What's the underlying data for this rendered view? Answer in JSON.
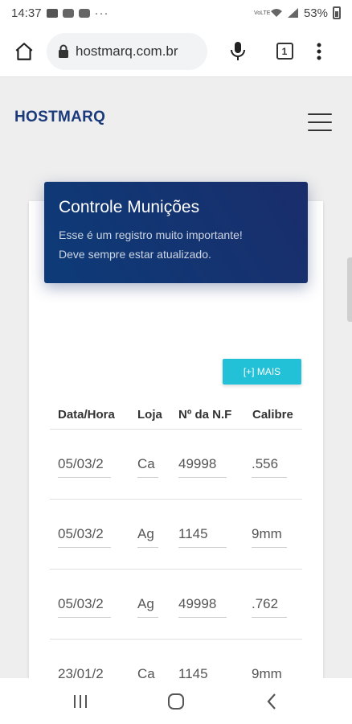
{
  "status_bar": {
    "time": "14:37",
    "icons": [
      "gallery-icon",
      "youtube-icon",
      "youtube-icon",
      "more-dots-icon"
    ],
    "more": "···",
    "network_label": "VoLTE",
    "battery": "53%"
  },
  "browser": {
    "url": "hostmarq.com.br",
    "tab_count": "1"
  },
  "page": {
    "brand": "HOSTMARQ"
  },
  "card": {
    "title": "Controle Munições",
    "subtitle": "Esse é um registro muito importante!\nDeve sempre estar atualizado.",
    "add_button": "[+] MAIS",
    "headers": [
      "Data/Hora",
      "Loja",
      "Nº da N.F",
      "Calibre"
    ],
    "rows": [
      [
        "05/03/2",
        "Ca",
        "49998",
        ".556"
      ],
      [
        "05/03/2",
        "Ag",
        "1145",
        "9mm"
      ],
      [
        "05/03/2",
        "Ag",
        "49998",
        ".762"
      ],
      [
        "23/01/2",
        "Ca",
        "1145",
        "9mm"
      ]
    ]
  },
  "colors": {
    "brand": "#1a3a7a",
    "header_gradient_start": "#0d3b78",
    "header_gradient_end": "#1a2d6b",
    "button": "#22c1d8"
  }
}
